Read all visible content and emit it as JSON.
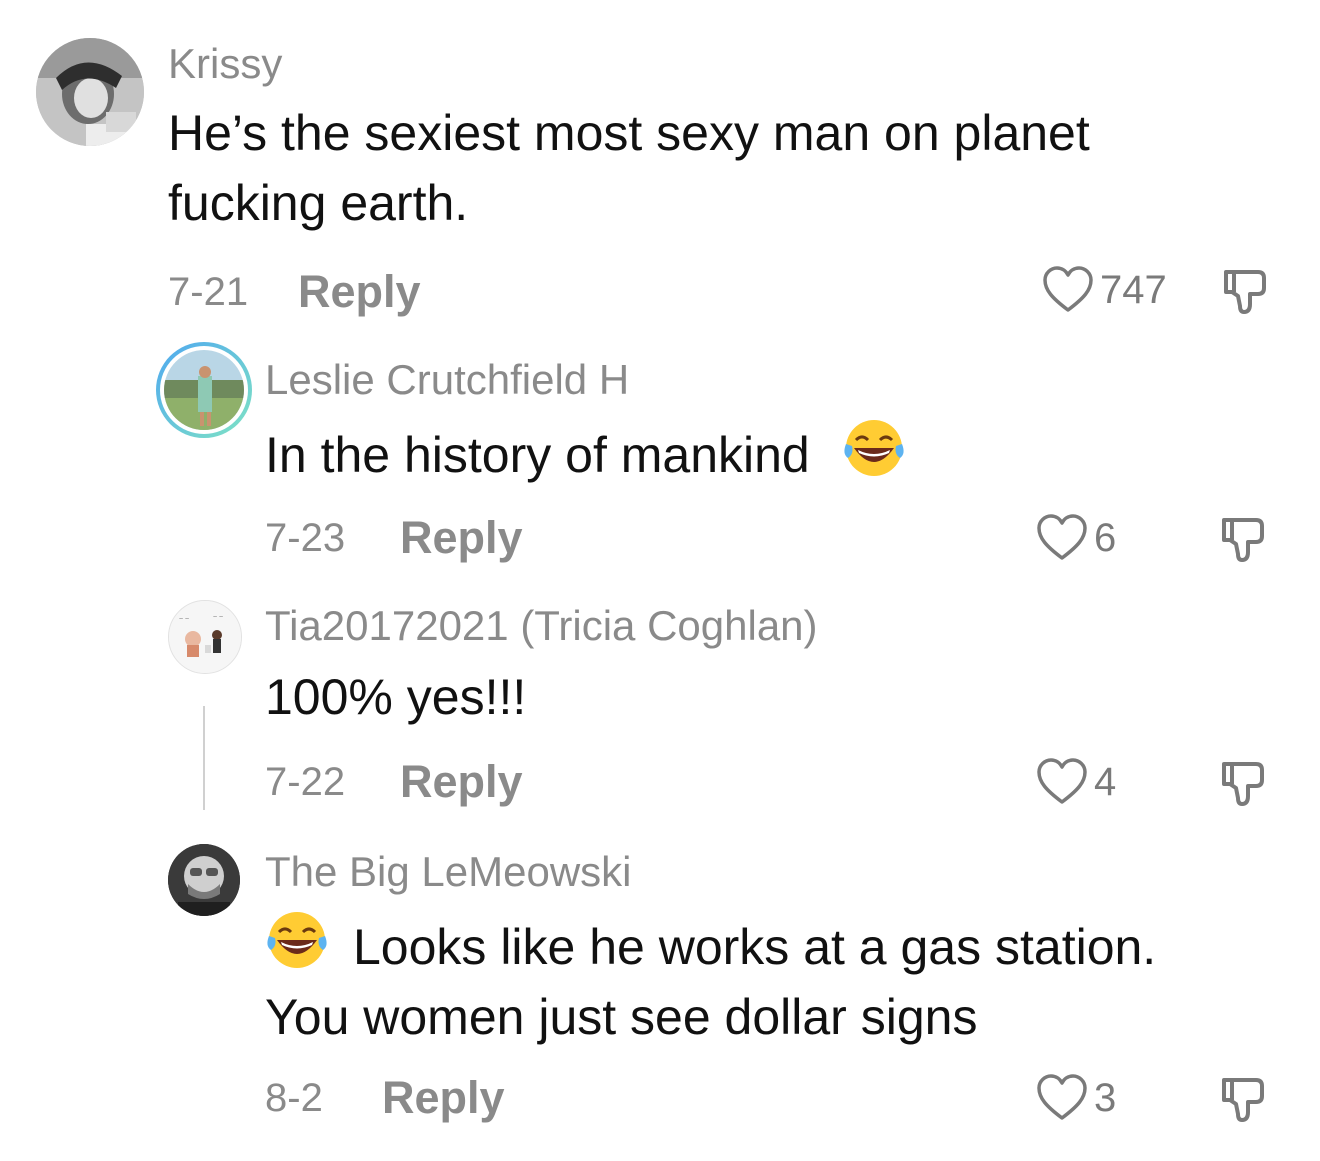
{
  "comments": [
    {
      "username": "Krissy",
      "text_lines": [
        "He’s the sexiest most sexy man on planet",
        "fucking earth."
      ],
      "date": "7-21",
      "reply_label": "Reply",
      "likes": "747"
    },
    {
      "username": "Leslie Crutchfield H",
      "text_lines": [
        "In the history of mankind"
      ],
      "date": "7-23",
      "reply_label": "Reply",
      "likes": "6"
    },
    {
      "username": "Tia20172021 (Tricia Coghlan)",
      "text_lines": [
        "100% yes!!!"
      ],
      "date": "7-22",
      "reply_label": "Reply",
      "likes": "4"
    },
    {
      "username": "The Big LeMeowski",
      "text_lines": [
        "Looks like he works at a gas station.",
        "You women just see dollar signs"
      ],
      "date": "8-2",
      "reply_label": "Reply",
      "likes": "3"
    }
  ],
  "icons": {
    "like": "heart-outline-icon",
    "dislike": "thumbs-down-icon",
    "emoji": "face-with-tears-of-joy"
  },
  "colors": {
    "muted_text": "#8a8a8a",
    "body_text": "#111111",
    "story_ring_start": "#4fa8f0",
    "story_ring_end": "#7fe3c4"
  }
}
